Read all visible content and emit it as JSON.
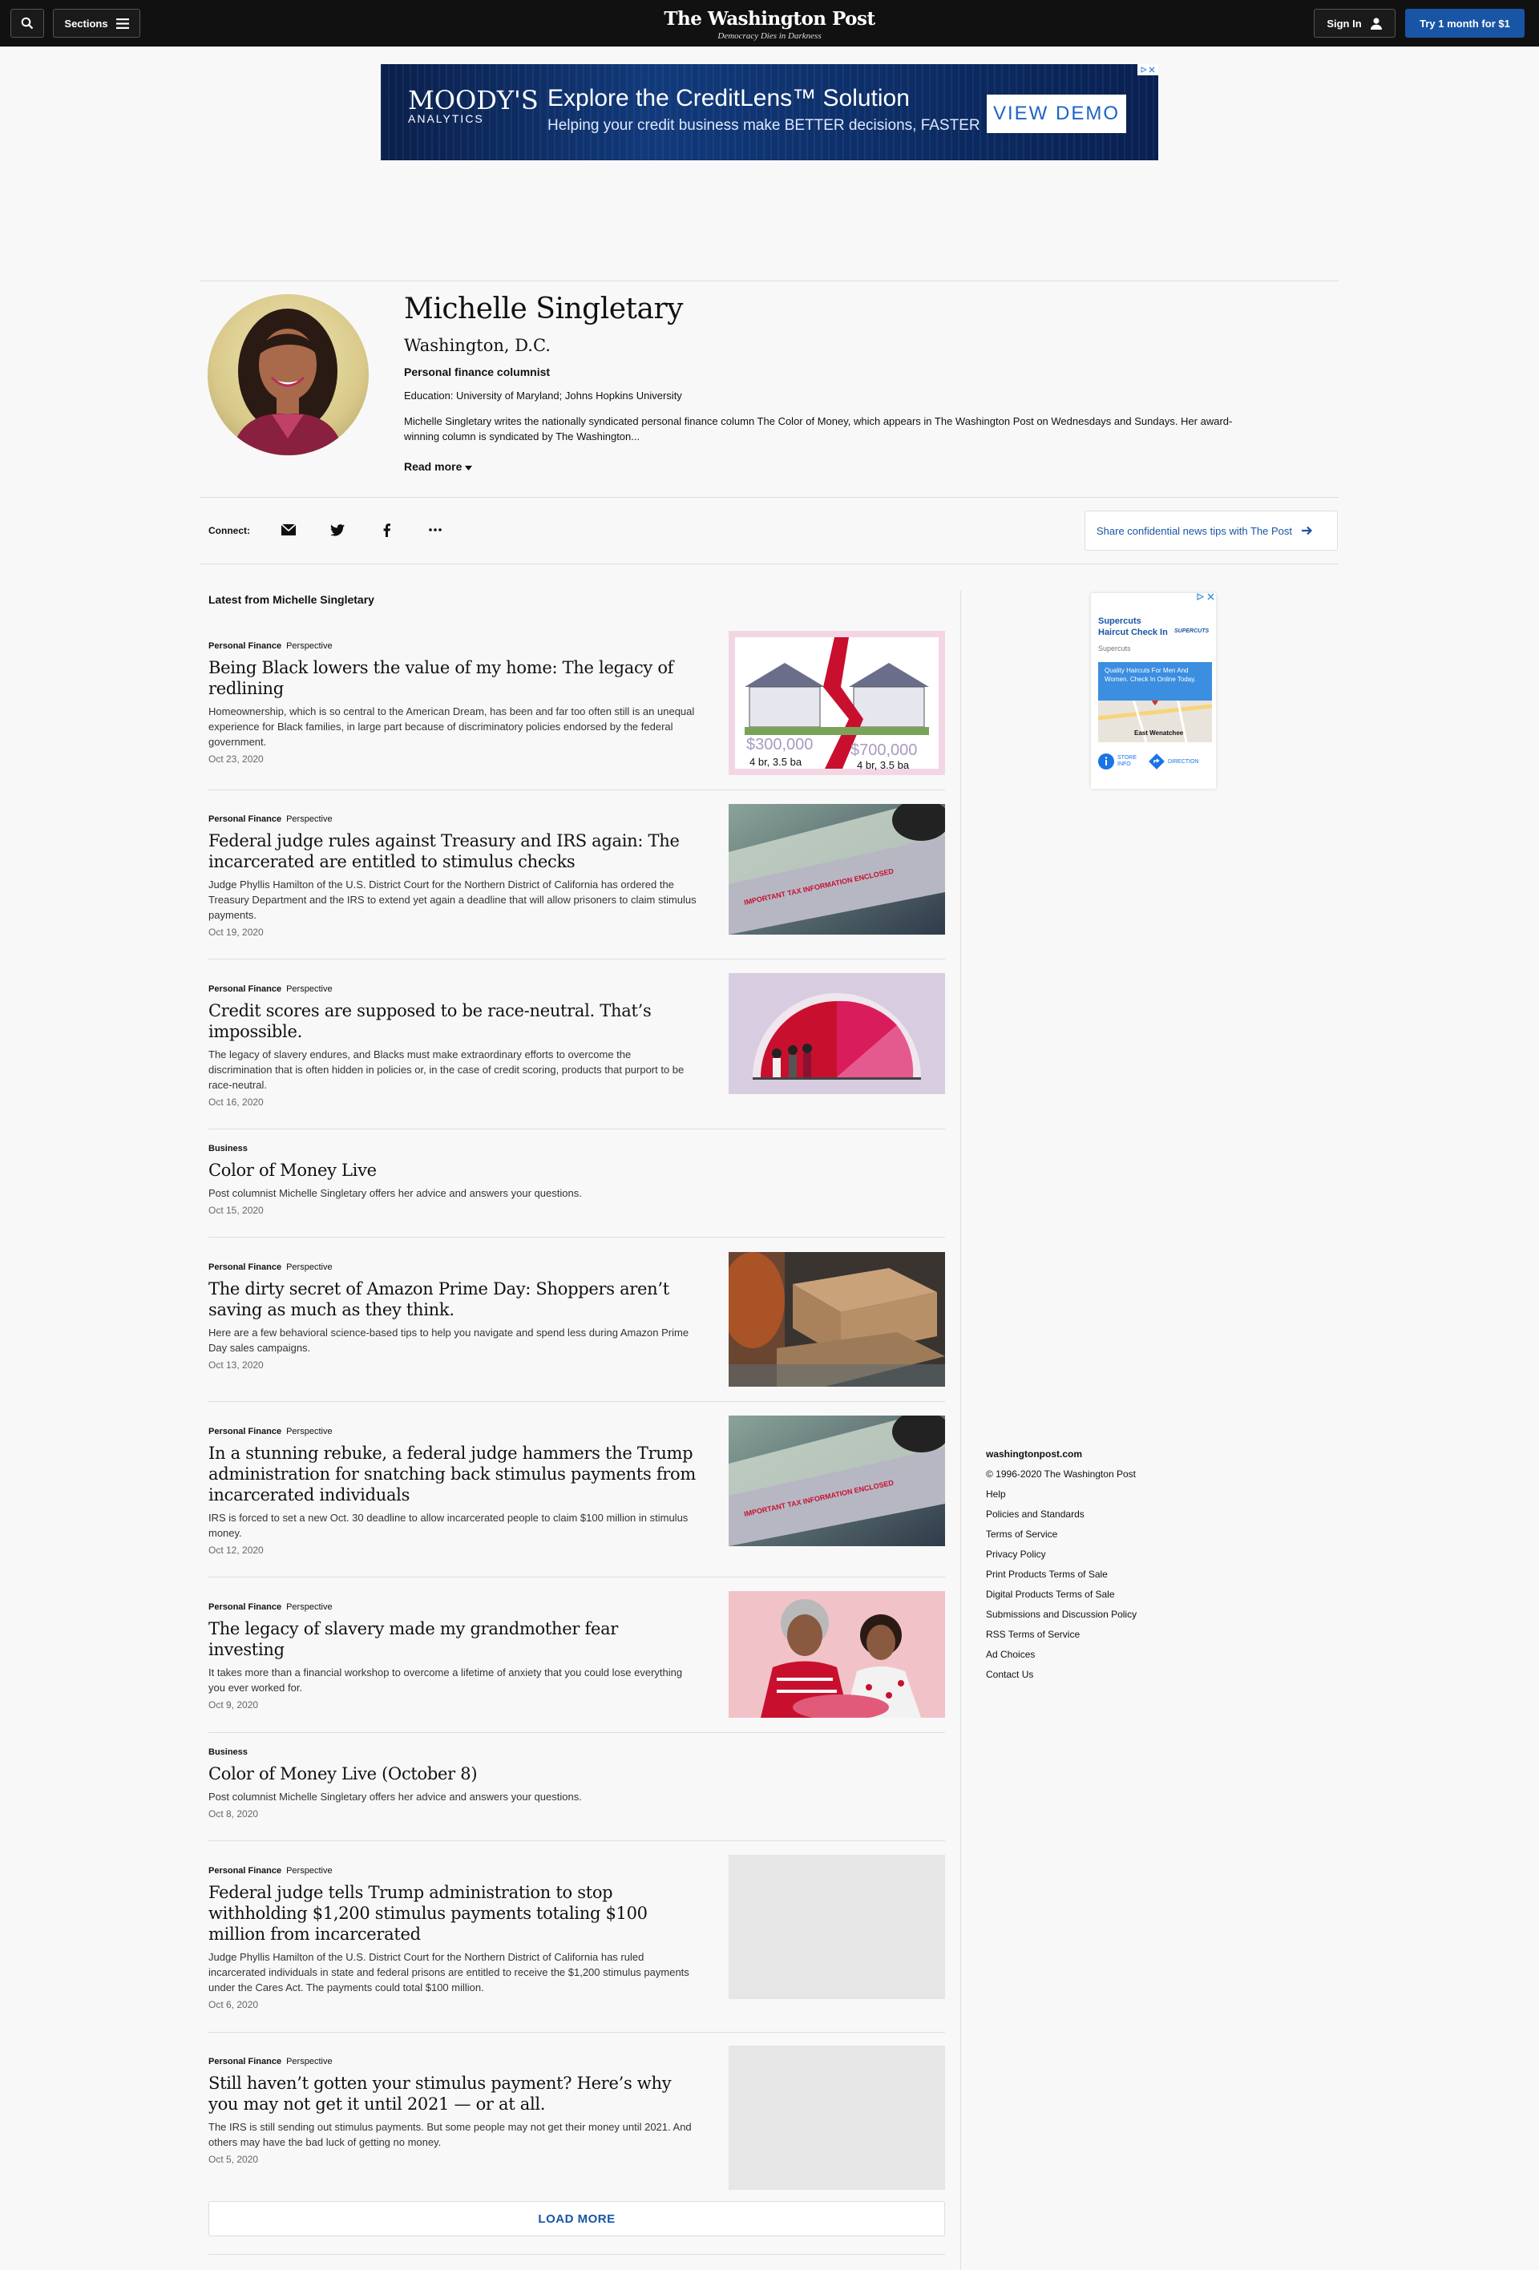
{
  "header": {
    "sections_label": "Sections",
    "logo_name": "The Washington Post",
    "logo_tagline": "Democracy Dies in Darkness",
    "signin_label": "Sign In",
    "subscribe_label": "Try 1 month for $1"
  },
  "top_ad": {
    "brand": "MOODY'S",
    "brand_sub": "ANALYTICS",
    "headline": "Explore the CreditLens™ Solution",
    "subline": "Helping your credit business make BETTER decisions, FASTER",
    "cta": "VIEW DEMO"
  },
  "profile": {
    "name": "Michelle Singletary",
    "location": "Washington, D.C.",
    "title": "Personal finance columnist",
    "education": "Education: University of Maryland; Johns Hopkins University",
    "bio": "Michelle Singletary writes the nationally syndicated personal finance column The Color of Money, which appears in The Washington Post on Wednesdays and Sundays. Her award-winning column is syndicated by The Washington...",
    "read_more": "Read more"
  },
  "connect": {
    "label": "Connect:",
    "share_tips": "Share confidential news tips with The Post"
  },
  "latest_heading": "Latest from Michelle Singletary",
  "articles": [
    {
      "section": "Personal Finance",
      "label": "Perspective",
      "headline": "Being Black lowers the value of my home: The legacy of redlining",
      "blurb": "Homeownership, which is so central to the American Dream, has been and far too often still is an unequal experience for Black families, in large part because of discriminatory policies endorsed by the federal government.",
      "date": "Oct 23, 2020",
      "thumb": "houses-illustration",
      "price_left": "$300,000",
      "price_right": "$700,000",
      "spec": "4 br, 3.5 ba"
    },
    {
      "section": "Personal Finance",
      "label": "Perspective",
      "headline": "Federal judge rules against Treasury and IRS again: The incarcerated are entitled to stimulus checks",
      "blurb": "Judge Phyllis Hamilton of the U.S. District Court for the Northern District of California has ordered the Treasury Department and the IRS to extend yet again a deadline that will allow prisoners to claim stimulus payments.",
      "date": "Oct 19, 2020",
      "thumb": "stimulus-check-photo",
      "envelope_text": "IMPORTANT TAX INFORMATION ENCLOSED"
    },
    {
      "section": "Personal Finance",
      "label": "Perspective",
      "headline": "Credit scores are supposed to be race-neutral. That’s impossible.",
      "blurb": "The legacy of slavery endures, and Blacks must make extraordinary efforts to overcome the discrimination that is often hidden in policies or, in the case of credit scoring, products that purport to be race-neutral.",
      "date": "Oct 16, 2020",
      "thumb": "credit-gauge-illustration"
    },
    {
      "section": "Business",
      "label": "",
      "headline": "Color of Money Live",
      "blurb": "Post columnist Michelle Singletary offers her advice and answers your questions.",
      "date": "Oct 15, 2020",
      "thumb": ""
    },
    {
      "section": "Personal Finance",
      "label": "Perspective",
      "headline": "The dirty secret of Amazon Prime Day: Shoppers aren’t saving as much as they think.",
      "blurb": "Here are a few behavioral science-based tips to help you navigate and spend less during Amazon Prime Day sales campaigns.",
      "date": "Oct 13, 2020",
      "thumb": "amazon-boxes-photo"
    },
    {
      "section": "Personal Finance",
      "label": "Perspective",
      "headline": "In a stunning rebuke, a federal judge hammers the Trump administration for snatching back stimulus payments from incarcerated individuals",
      "blurb": "IRS is forced to set a new Oct. 30 deadline to allow incarcerated people to claim $100 million in stimulus money.",
      "date": "Oct 12, 2020",
      "thumb": "stimulus-check-photo",
      "envelope_text": "IMPORTANT TAX INFORMATION ENCLOSED"
    },
    {
      "section": "Personal Finance",
      "label": "Perspective",
      "headline": "The legacy of slavery made my grandmother fear investing",
      "blurb": "It takes more than a financial workshop to overcome a lifetime of anxiety that you could lose everything you ever worked for.",
      "date": "Oct 9, 2020",
      "thumb": "grandmother-illustration"
    },
    {
      "section": "Business",
      "label": "",
      "headline": "Color of Money Live (October 8)",
      "blurb": "Post columnist Michelle Singletary offers her advice and answers your questions.",
      "date": "Oct 8, 2020",
      "thumb": ""
    },
    {
      "section": "Personal Finance",
      "label": "Perspective",
      "headline": "Federal judge tells Trump administration to stop withholding $1,200 stimulus payments totaling $100 million from incarcerated",
      "blurb": "Judge Phyllis Hamilton of the U.S. District Court for the Northern District of California has ruled incarcerated individuals in state and federal prisons are entitled to receive the $1,200 stimulus payments under the Cares Act. The payments could total $100 million.",
      "date": "Oct 6, 2020",
      "thumb": "placeholder"
    },
    {
      "section": "Personal Finance",
      "label": "Perspective",
      "headline": "Still haven’t gotten your stimulus payment? Here’s why you may not get it until 2021 — or at all.",
      "blurb": "The IRS is still sending out stimulus payments. But some people may not get their money until 2021. And others may have the bad luck of getting no money.",
      "date": "Oct 5, 2020",
      "thumb": "placeholder"
    }
  ],
  "load_more": "LOAD MORE",
  "side_ad": {
    "title": "Supercuts Haircut Check In",
    "brand_mark": "SUPERCUTS",
    "advertiser": "Supercuts",
    "promo": "Quality Haircuts For Men And Women. Check In Online Today.",
    "map_label": "East Wenatchee",
    "store_info": "STORE INFO",
    "directions": "DIRECTION"
  },
  "footer": {
    "site": "washingtonpost.com",
    "copyright": "© 1996-2020 The Washington Post",
    "links": [
      "Help",
      "Policies and Standards",
      "Terms of Service",
      "Privacy Policy",
      "Print Products Terms of Sale",
      "Digital Products Terms of Sale",
      "Submissions and Discussion Policy",
      "RSS Terms of Service",
      "Ad Choices",
      "Contact Us"
    ]
  },
  "colors": {
    "accent": "#1955a5",
    "topbar": "#111111",
    "page_bg": "#f8f8f8"
  }
}
